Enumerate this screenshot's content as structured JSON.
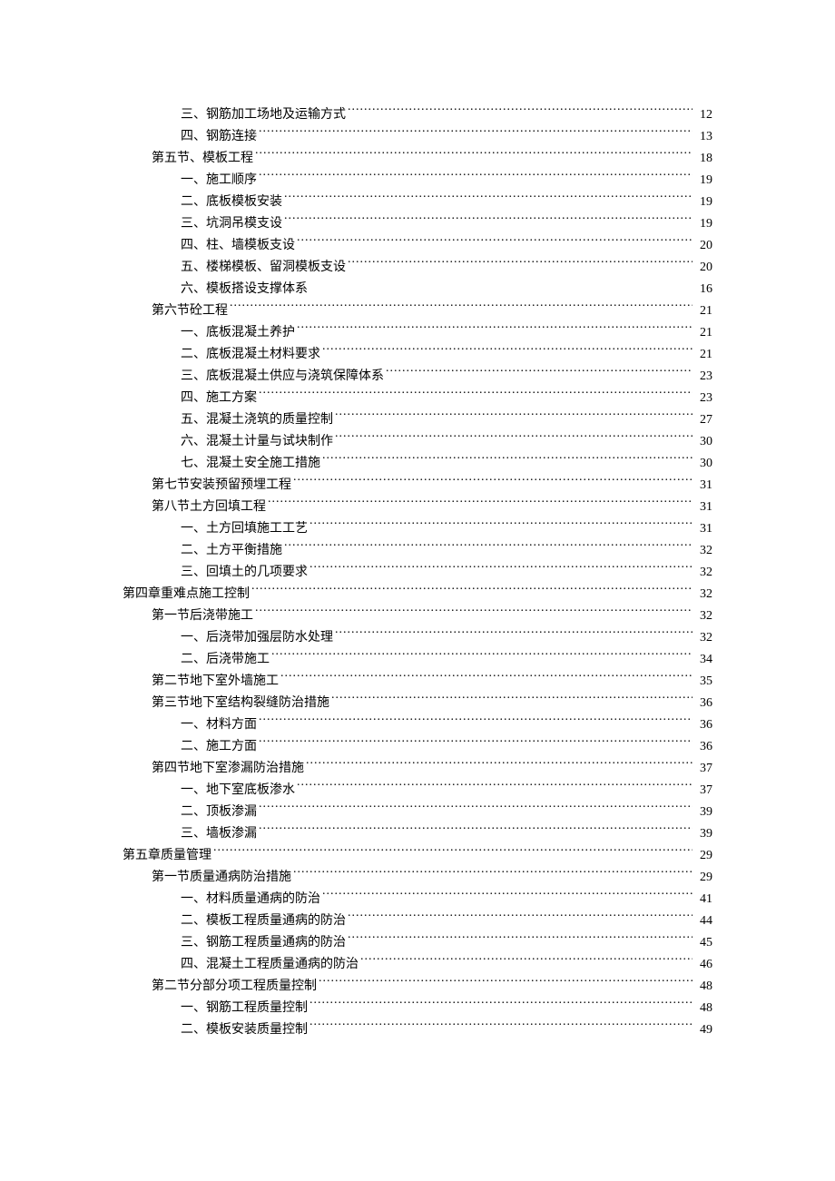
{
  "entries": [
    {
      "indent": 2,
      "label": "三、钢筋加工场地及运输方式",
      "page": "12",
      "dots": true
    },
    {
      "indent": 2,
      "label": "四、钢筋连接",
      "page": "13",
      "dots": true
    },
    {
      "indent": 1,
      "label": "第五节、模板工程",
      "page": "18",
      "dots": true
    },
    {
      "indent": 2,
      "label": "一、施工顺序",
      "page": "19",
      "dots": true
    },
    {
      "indent": 2,
      "label": "二、底板模板安装",
      "page": "19",
      "dots": true
    },
    {
      "indent": 2,
      "label": "三、坑洞吊模支设",
      "page": "19",
      "dots": true
    },
    {
      "indent": 2,
      "label": "四、柱、墙模板支设",
      "page": "20",
      "dots": true
    },
    {
      "indent": 2,
      "label": "五、楼梯模板、留洞模板支设",
      "page": "20",
      "dots": true
    },
    {
      "indent": 2,
      "label": "六、模板搭设支撑体系",
      "page": "16",
      "dots": false
    },
    {
      "indent": 1,
      "label": "第六节砼工程",
      "page": "21",
      "dots": true
    },
    {
      "indent": 2,
      "label": "一、底板混凝土养护",
      "page": "21",
      "dots": true
    },
    {
      "indent": 2,
      "label": "二、底板混凝土材料要求",
      "page": "21",
      "dots": true
    },
    {
      "indent": 2,
      "label": "三、底板混凝土供应与浇筑保障体系",
      "page": "23",
      "dots": true
    },
    {
      "indent": 2,
      "label": "四、施工方案",
      "page": "23",
      "dots": true
    },
    {
      "indent": 2,
      "label": "五、混凝土浇筑的质量控制",
      "page": "27",
      "dots": true
    },
    {
      "indent": 2,
      "label": "六、混凝土计量与试块制作",
      "page": "30",
      "dots": true
    },
    {
      "indent": 2,
      "label": "七、混凝土安全施工措施",
      "page": "30",
      "dots": true
    },
    {
      "indent": 1,
      "label": "第七节安装预留预埋工程",
      "page": "31",
      "dots": true
    },
    {
      "indent": 1,
      "label": "第八节土方回填工程",
      "page": "31",
      "dots": true
    },
    {
      "indent": 2,
      "label": "一、土方回填施工工艺",
      "page": "31",
      "dots": true
    },
    {
      "indent": 2,
      "label": "二、土方平衡措施",
      "page": "32",
      "dots": true
    },
    {
      "indent": 2,
      "label": "三、回填土的几项要求",
      "page": "32",
      "dots": true
    },
    {
      "indent": 0,
      "label": "第四章重难点施工控制",
      "page": "32",
      "dots": true
    },
    {
      "indent": 1,
      "label": "第一节后浇带施工",
      "page": "32",
      "dots": true
    },
    {
      "indent": 2,
      "label": "一、后浇带加强层防水处理",
      "page": "32",
      "dots": true
    },
    {
      "indent": 2,
      "label": "二、后浇带施工",
      "page": "34",
      "dots": true
    },
    {
      "indent": 1,
      "label": "第二节地下室外墙施工",
      "page": "35",
      "dots": true
    },
    {
      "indent": 1,
      "label": "第三节地下室结构裂缝防治措施",
      "page": "36",
      "dots": true
    },
    {
      "indent": 2,
      "label": "一、材料方面",
      "page": "36",
      "dots": true
    },
    {
      "indent": 2,
      "label": "二、施工方面",
      "page": "36",
      "dots": true
    },
    {
      "indent": 1,
      "label": "第四节地下室渗漏防治措施",
      "page": "37",
      "dots": true
    },
    {
      "indent": 2,
      "label": "一、地下室底板渗水",
      "page": "37",
      "dots": true
    },
    {
      "indent": 2,
      "label": "二、顶板渗漏",
      "page": "39",
      "dots": true
    },
    {
      "indent": 2,
      "label": "三、墙板渗漏",
      "page": "39",
      "dots": true
    },
    {
      "indent": 0,
      "label": "第五章质量管理",
      "page": "29",
      "dots": true
    },
    {
      "indent": 1,
      "label": "第一节质量通病防治措施",
      "page": "29",
      "dots": true
    },
    {
      "indent": 2,
      "label": "一、材料质量通病的防治",
      "page": "41",
      "dots": true
    },
    {
      "indent": 2,
      "label": "二、模板工程质量通病的防治",
      "page": "44",
      "dots": true
    },
    {
      "indent": 2,
      "label": "三、钢筋工程质量通病的防治",
      "page": "45",
      "dots": true
    },
    {
      "indent": 2,
      "label": "四、混凝土工程质量通病的防治",
      "page": "46",
      "dots": true
    },
    {
      "indent": 1,
      "label": "第二节分部分项工程质量控制",
      "page": "48",
      "dots": true
    },
    {
      "indent": 2,
      "label": "一、钢筋工程质量控制",
      "page": "48",
      "dots": true
    },
    {
      "indent": 2,
      "label": "二、模板安装质量控制",
      "page": "49",
      "dots": true
    }
  ]
}
